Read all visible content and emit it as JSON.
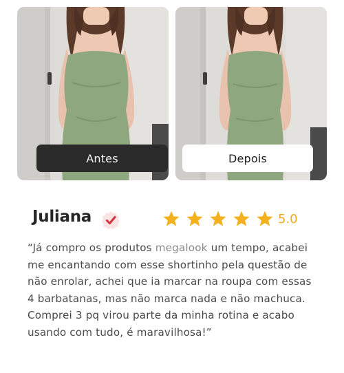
{
  "comparison": {
    "before_label": "Antes",
    "after_label": "Depois"
  },
  "review": {
    "name": "Juliana",
    "verified": true,
    "rating": 5,
    "rating_text": "5.0",
    "text_part1": "“Já compro os produtos ",
    "brand": "megalook",
    "text_part2": " um tempo, acabei me encantando com esse shortinho pela questão de não enrolar, achei que ia marcar na roupa com essas 4 barbatanas, mas não marca nada e não machuca. Comprei 3 pq virou parte da minha rotina e acabo usando com tudo, é maravilhosa!”"
  },
  "colors": {
    "star": "#f4b11f",
    "badge_check": "#d0313a",
    "badge_bg": "#fbe3e4",
    "dress": "#8fa77f",
    "before_label_bg": "#2a2a2a",
    "after_label_bg": "#ffffff"
  },
  "icons": {
    "badge": "verified-check-icon",
    "star": "star-icon"
  }
}
